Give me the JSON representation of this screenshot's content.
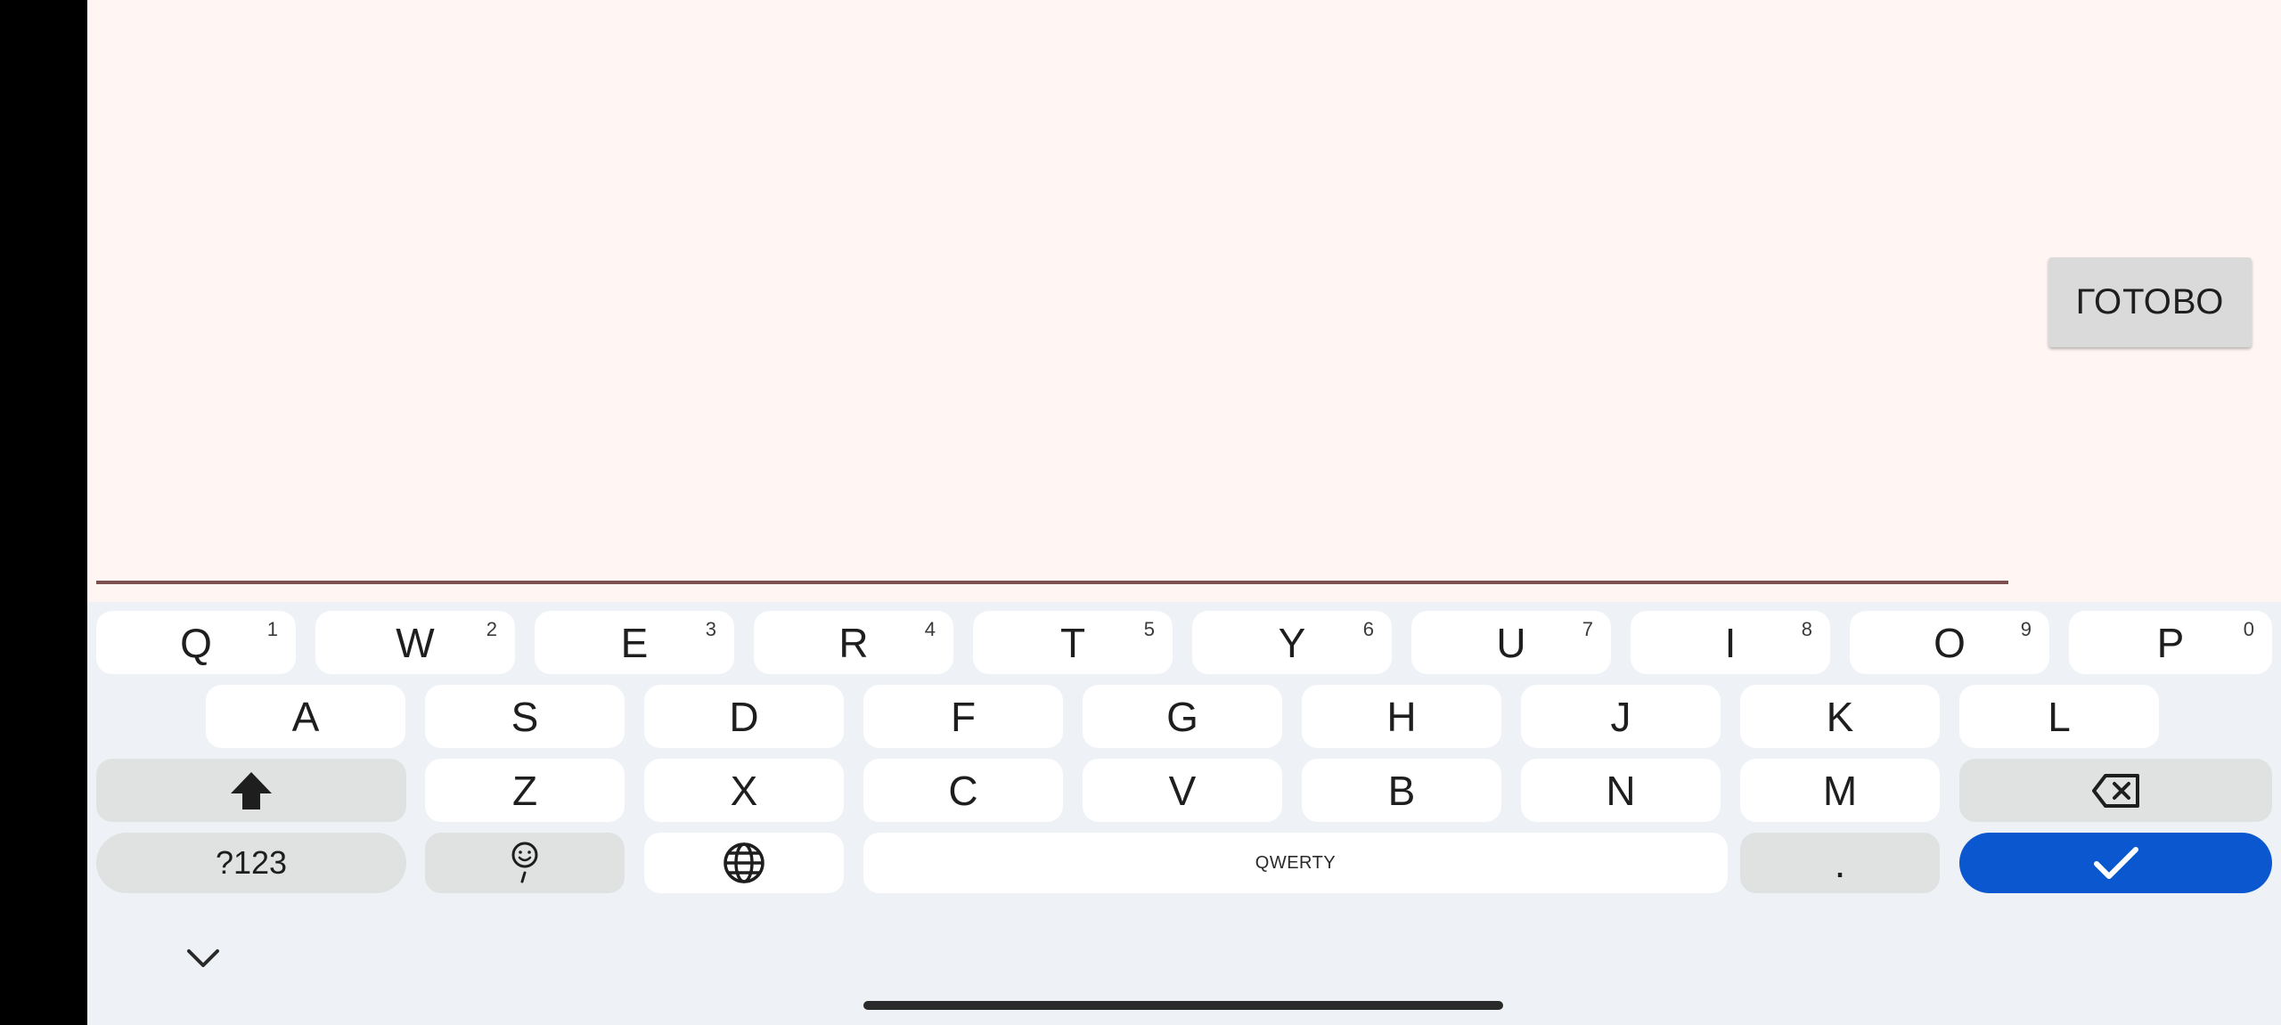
{
  "app": {
    "done_button_label": "ГОТОВО"
  },
  "keyboard": {
    "row1": [
      {
        "label": "Q",
        "hint": "1"
      },
      {
        "label": "W",
        "hint": "2"
      },
      {
        "label": "E",
        "hint": "3"
      },
      {
        "label": "R",
        "hint": "4"
      },
      {
        "label": "T",
        "hint": "5"
      },
      {
        "label": "Y",
        "hint": "6"
      },
      {
        "label": "U",
        "hint": "7"
      },
      {
        "label": "I",
        "hint": "8"
      },
      {
        "label": "O",
        "hint": "9"
      },
      {
        "label": "P",
        "hint": "0"
      }
    ],
    "row2": [
      {
        "label": "A"
      },
      {
        "label": "S"
      },
      {
        "label": "D"
      },
      {
        "label": "F"
      },
      {
        "label": "G"
      },
      {
        "label": "H"
      },
      {
        "label": "J"
      },
      {
        "label": "K"
      },
      {
        "label": "L"
      }
    ],
    "row3": [
      {
        "label": "Z"
      },
      {
        "label": "X"
      },
      {
        "label": "C"
      },
      {
        "label": "V"
      },
      {
        "label": "B"
      },
      {
        "label": "N"
      },
      {
        "label": "M"
      }
    ],
    "symbols_label": "?123",
    "space_label": "QWERTY",
    "period_label": ".",
    "icons": {
      "shift": "shift-icon",
      "backspace": "backspace-icon",
      "emoji": "emoji-icon",
      "language": "globe-icon",
      "enter": "checkmark-icon",
      "collapse": "chevron-down-icon"
    },
    "colors": {
      "action": "#0b57d0",
      "key": "#ffffff",
      "function_key": "#dfe2e0",
      "background": "#eef1f6"
    }
  },
  "colors": {
    "text_area_background": "#fff5f3",
    "underline": "#7d4f4f"
  }
}
